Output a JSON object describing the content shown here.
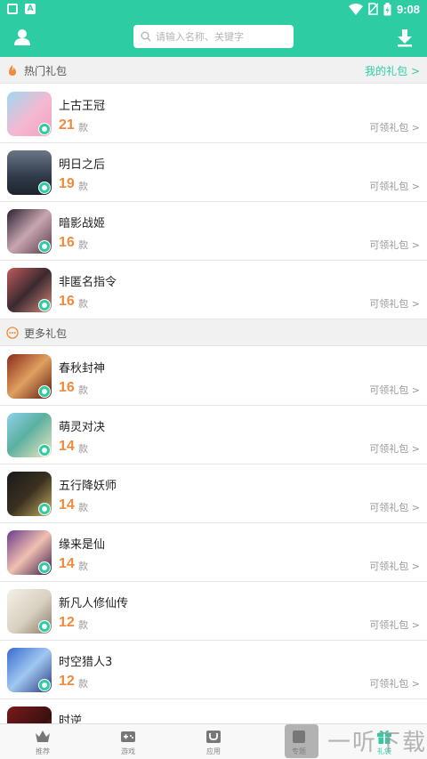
{
  "status_bar": {
    "time": "9:08",
    "a_icon": "A"
  },
  "header": {
    "search_placeholder": "请输入名称、关键字",
    "user_icon": "person-icon",
    "download_icon": "download-icon"
  },
  "hot_section": {
    "title": "热门礼包",
    "link": "我的礼包 >",
    "icon": "flame-icon"
  },
  "hot_items": [
    {
      "name": "上古王冠",
      "count": "21",
      "unit": "款",
      "action": "可领礼包 >"
    },
    {
      "name": "明日之后",
      "count": "19",
      "unit": "款",
      "action": "可领礼包 >"
    },
    {
      "name": "暗影战姬",
      "count": "16",
      "unit": "款",
      "action": "可领礼包 >"
    },
    {
      "name": "非匿名指令",
      "count": "16",
      "unit": "款",
      "action": "可领礼包 >"
    }
  ],
  "more_section": {
    "title": "更多礼包",
    "icon": "more-dots-icon"
  },
  "more_items": [
    {
      "name": "春秋封神",
      "count": "16",
      "unit": "款",
      "action": "可领礼包 >"
    },
    {
      "name": "萌灵对决",
      "count": "14",
      "unit": "款",
      "action": "可领礼包 >"
    },
    {
      "name": "五行降妖师",
      "count": "14",
      "unit": "款",
      "action": "可领礼包 >"
    },
    {
      "name": "缘来是仙",
      "count": "14",
      "unit": "款",
      "action": "可领礼包 >"
    },
    {
      "name": "新凡人修仙传",
      "count": "12",
      "unit": "款",
      "action": "可领礼包 >"
    },
    {
      "name": "时空猎人3",
      "count": "12",
      "unit": "款",
      "action": "可领礼包 >"
    },
    {
      "name": "时逆",
      "count": "",
      "unit": "",
      "action": ""
    }
  ],
  "bottom_nav": [
    {
      "label": "推荐",
      "icon": "crown-icon"
    },
    {
      "label": "游戏",
      "icon": "gamepad-icon"
    },
    {
      "label": "应用",
      "icon": "app-icon"
    },
    {
      "label": "专题",
      "icon": "topic-icon"
    },
    {
      "label": "礼袋",
      "icon": "gift-icon"
    }
  ],
  "watermark": {
    "text": "一听下载"
  },
  "colors": {
    "accent": "#2ecca3",
    "count": "#f08a3c"
  }
}
